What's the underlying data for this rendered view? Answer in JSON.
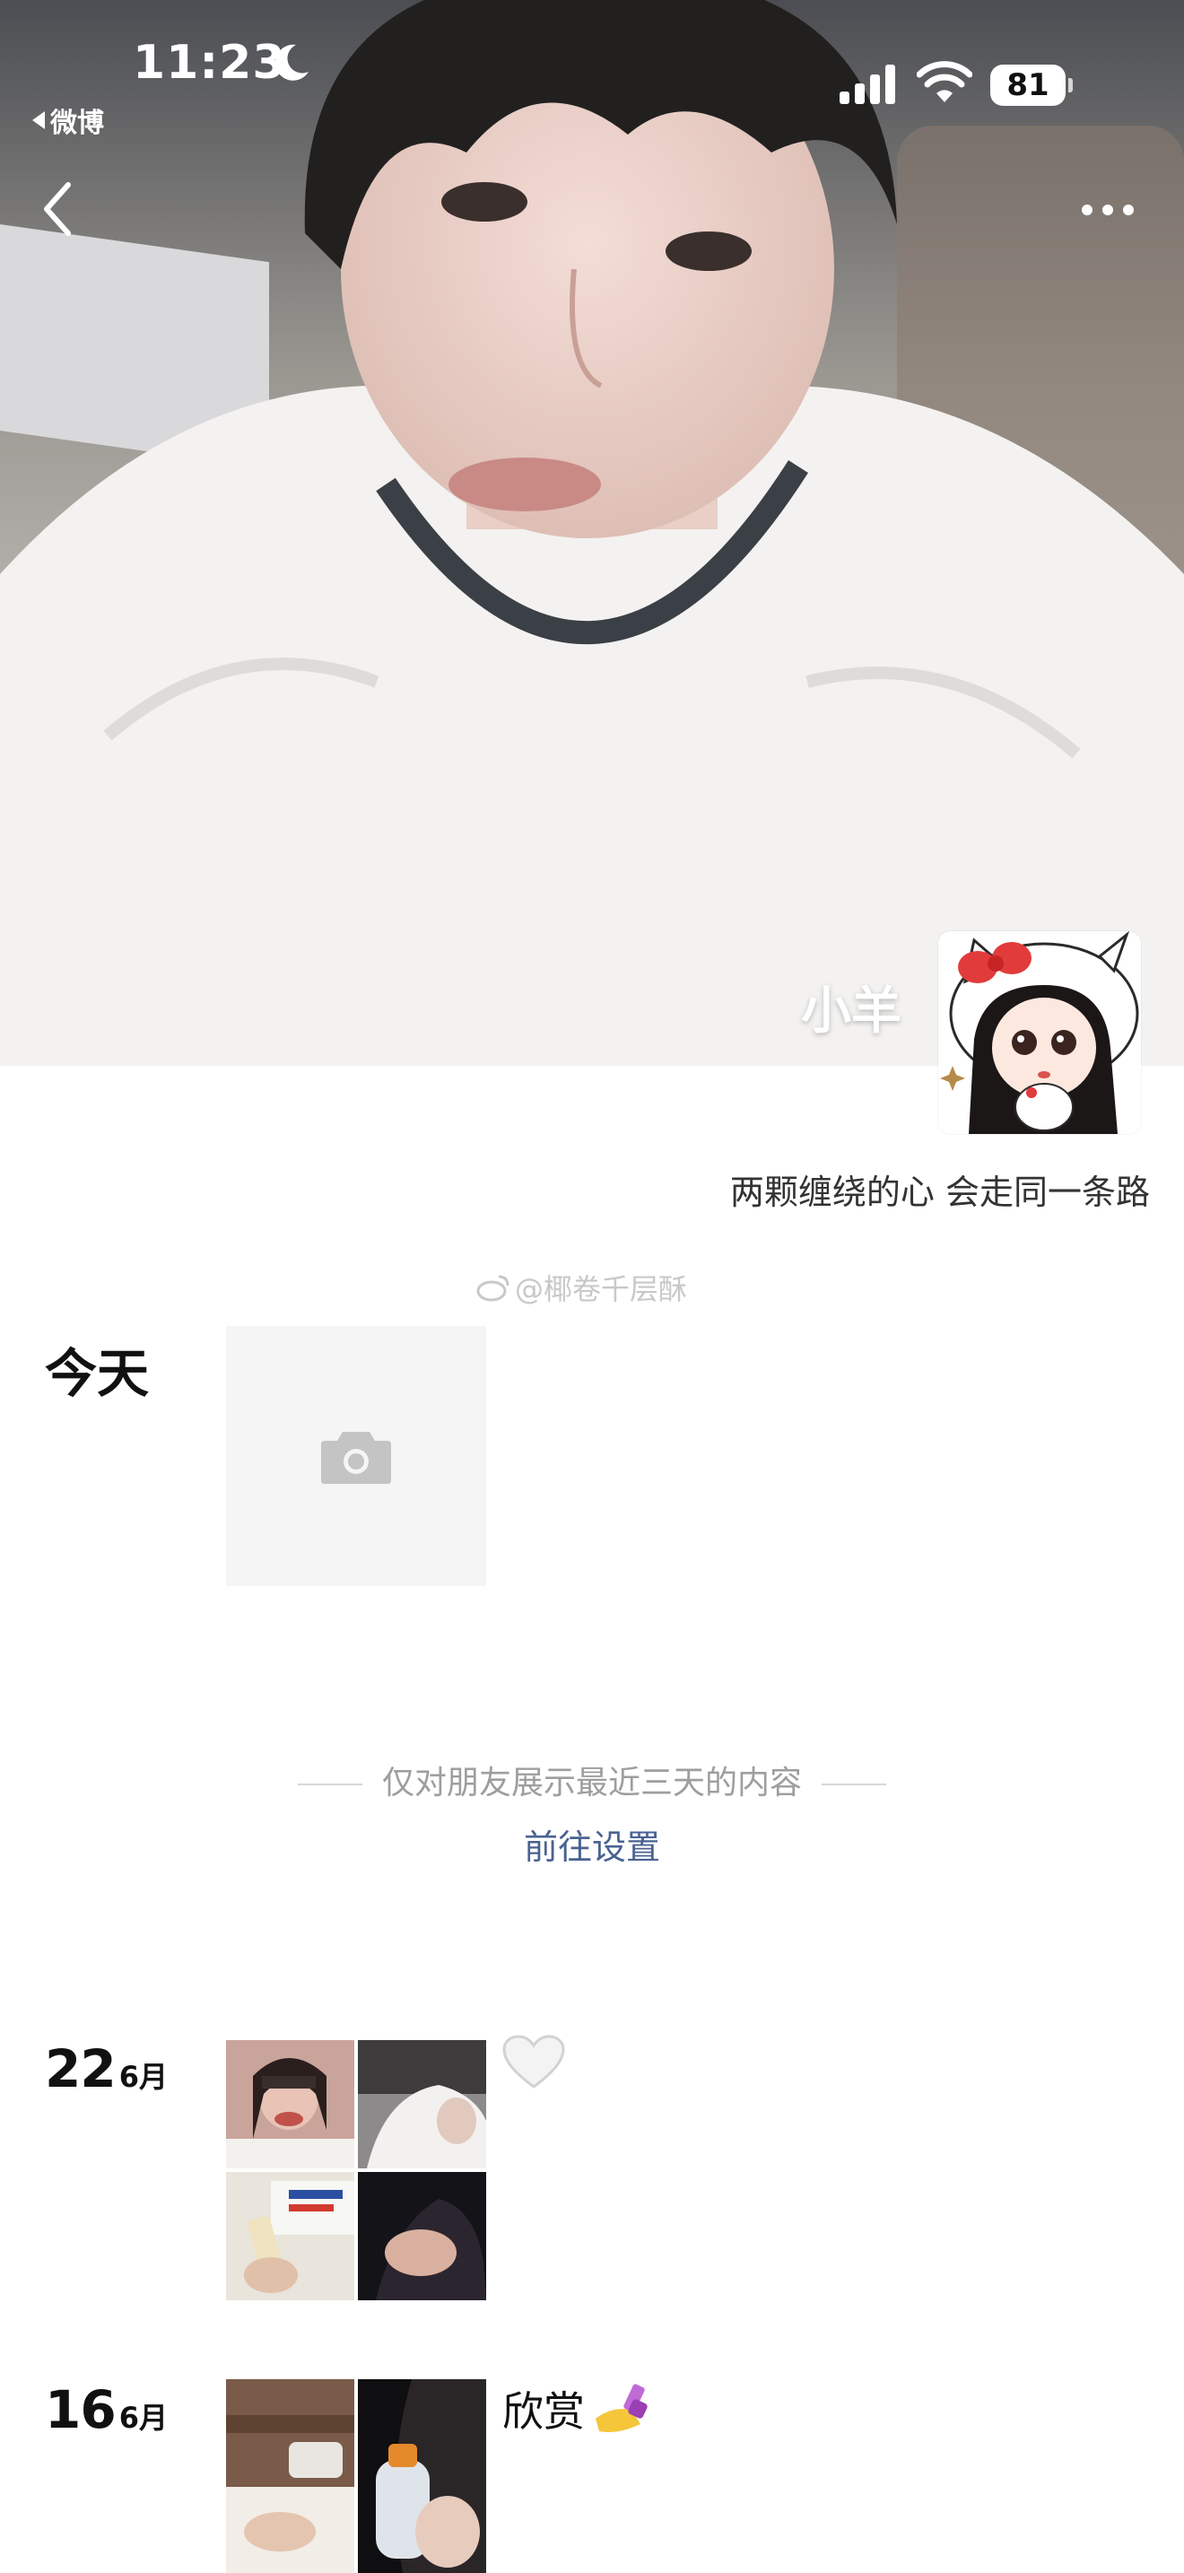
{
  "status_bar": {
    "time": "11:23",
    "back_app": "微博",
    "battery": "81"
  },
  "profile": {
    "nickname": "小羊",
    "signature": "两颗缠绕的心 会走同一条路"
  },
  "watermark": "@椰卷千层酥",
  "today": {
    "label": "今天"
  },
  "notice": {
    "text": "仅对朋友展示最近三天的内容",
    "link": "前往设置"
  },
  "moments": [
    {
      "day": "22",
      "month": "6月",
      "photo_count": 4,
      "text": "",
      "emoji": "white-heart-icon"
    },
    {
      "day": "16",
      "month": "6月",
      "photo_count": 2,
      "text": "欣赏",
      "emoji": "nail-polish-icon"
    }
  ],
  "colors": {
    "link": "#4a6292",
    "muted": "#9e9e9e",
    "tile_bg": "#f5f5f5"
  }
}
